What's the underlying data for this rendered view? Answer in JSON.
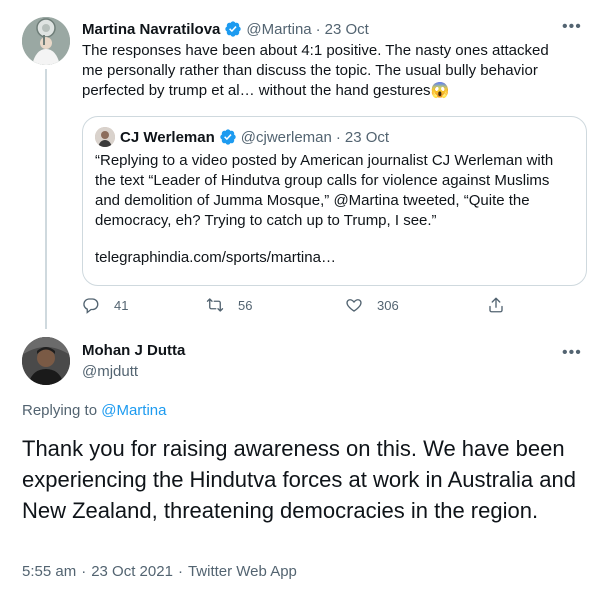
{
  "tweet1": {
    "author_name": "Martina Navratilova",
    "handle": "@Martina",
    "separator": "·",
    "date": "23 Oct",
    "text": "The responses have been about 4:1 positive. The nasty ones attacked me personally rather than discuss the topic. The usual bully behavior perfected by trump et al… without the hand gestures😱",
    "quote": {
      "author_name": "CJ Werleman",
      "handle": "@cjwerleman",
      "separator": "·",
      "date": "23 Oct",
      "text": "“Replying to a video posted by American journalist CJ Werleman with the text “Leader of Hindutva group calls for violence against Muslims and demolition of Jumma Mosque,” @Martina tweeted, “Quite the democracy, eh? Trying to catch up to Trump, I see.”",
      "link": "telegraphindia.com/sports/martina…"
    },
    "actions": {
      "replies": "41",
      "retweets": "56",
      "likes": "306"
    }
  },
  "tweet2": {
    "author_name": "Mohan J Dutta",
    "handle": "@mjdutt",
    "replying_prefix": "Replying to",
    "replying_handle": "@Martina",
    "text": "Thank you for raising awareness on this. We have been experiencing the Hindutva forces at work in Australia and New Zealand, threatening democracies in the region.",
    "time": "5:55 am",
    "date": "23 Oct 2021",
    "source": "Twitter Web App",
    "separator": "·"
  },
  "colors": {
    "accent": "#1d9bf0",
    "muted": "#536471",
    "border": "#cfd9de",
    "text": "#0f1419"
  }
}
